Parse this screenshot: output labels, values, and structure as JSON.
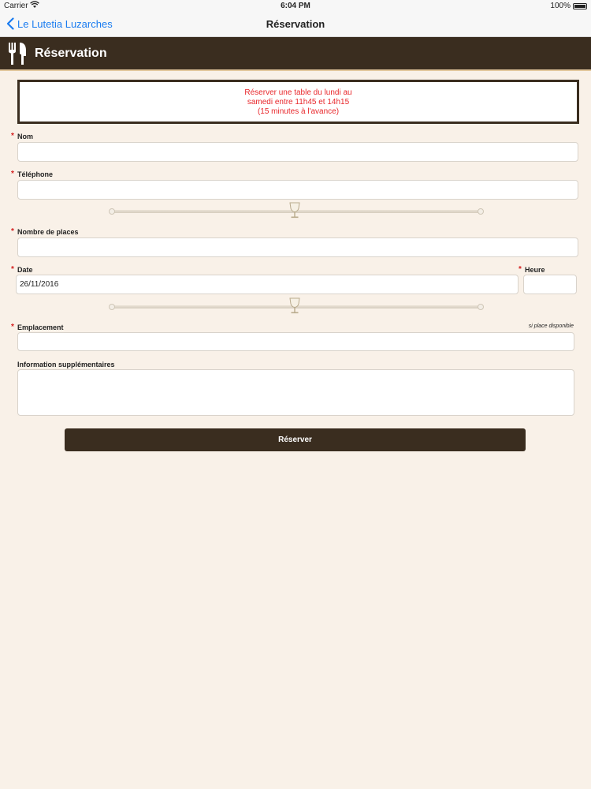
{
  "status_bar": {
    "carrier": "Carrier",
    "time": "6:04 PM",
    "battery": "100%"
  },
  "nav": {
    "back_label": "Le Lutetia Luzarches",
    "title": "Réservation"
  },
  "header": {
    "title": "Réservation"
  },
  "notice": {
    "lines": [
      "Réserver une table du lundi au",
      "samedi entre 11h45 et 14h15",
      "(15 minutes à l'avance)"
    ]
  },
  "form": {
    "required_marker": "*",
    "nom": {
      "label": "Nom",
      "value": ""
    },
    "telephone": {
      "label": "Téléphone",
      "value": ""
    },
    "nombre_places": {
      "label": "Nombre de places",
      "value": ""
    },
    "date": {
      "label": "Date",
      "value": "26/11/2016"
    },
    "heure": {
      "label": "Heure",
      "value": ""
    },
    "emplacement": {
      "label": "Emplacement",
      "note": "si place disponible",
      "value": ""
    },
    "info": {
      "label": "Information supplémentaires",
      "value": ""
    },
    "submit_label": "Réserver"
  },
  "colors": {
    "brand_dark": "#3a2d1f",
    "background": "#f9f1e8",
    "accent_link": "#1a7cf0",
    "notice_text": "#e8262a",
    "required": "#d42020"
  }
}
